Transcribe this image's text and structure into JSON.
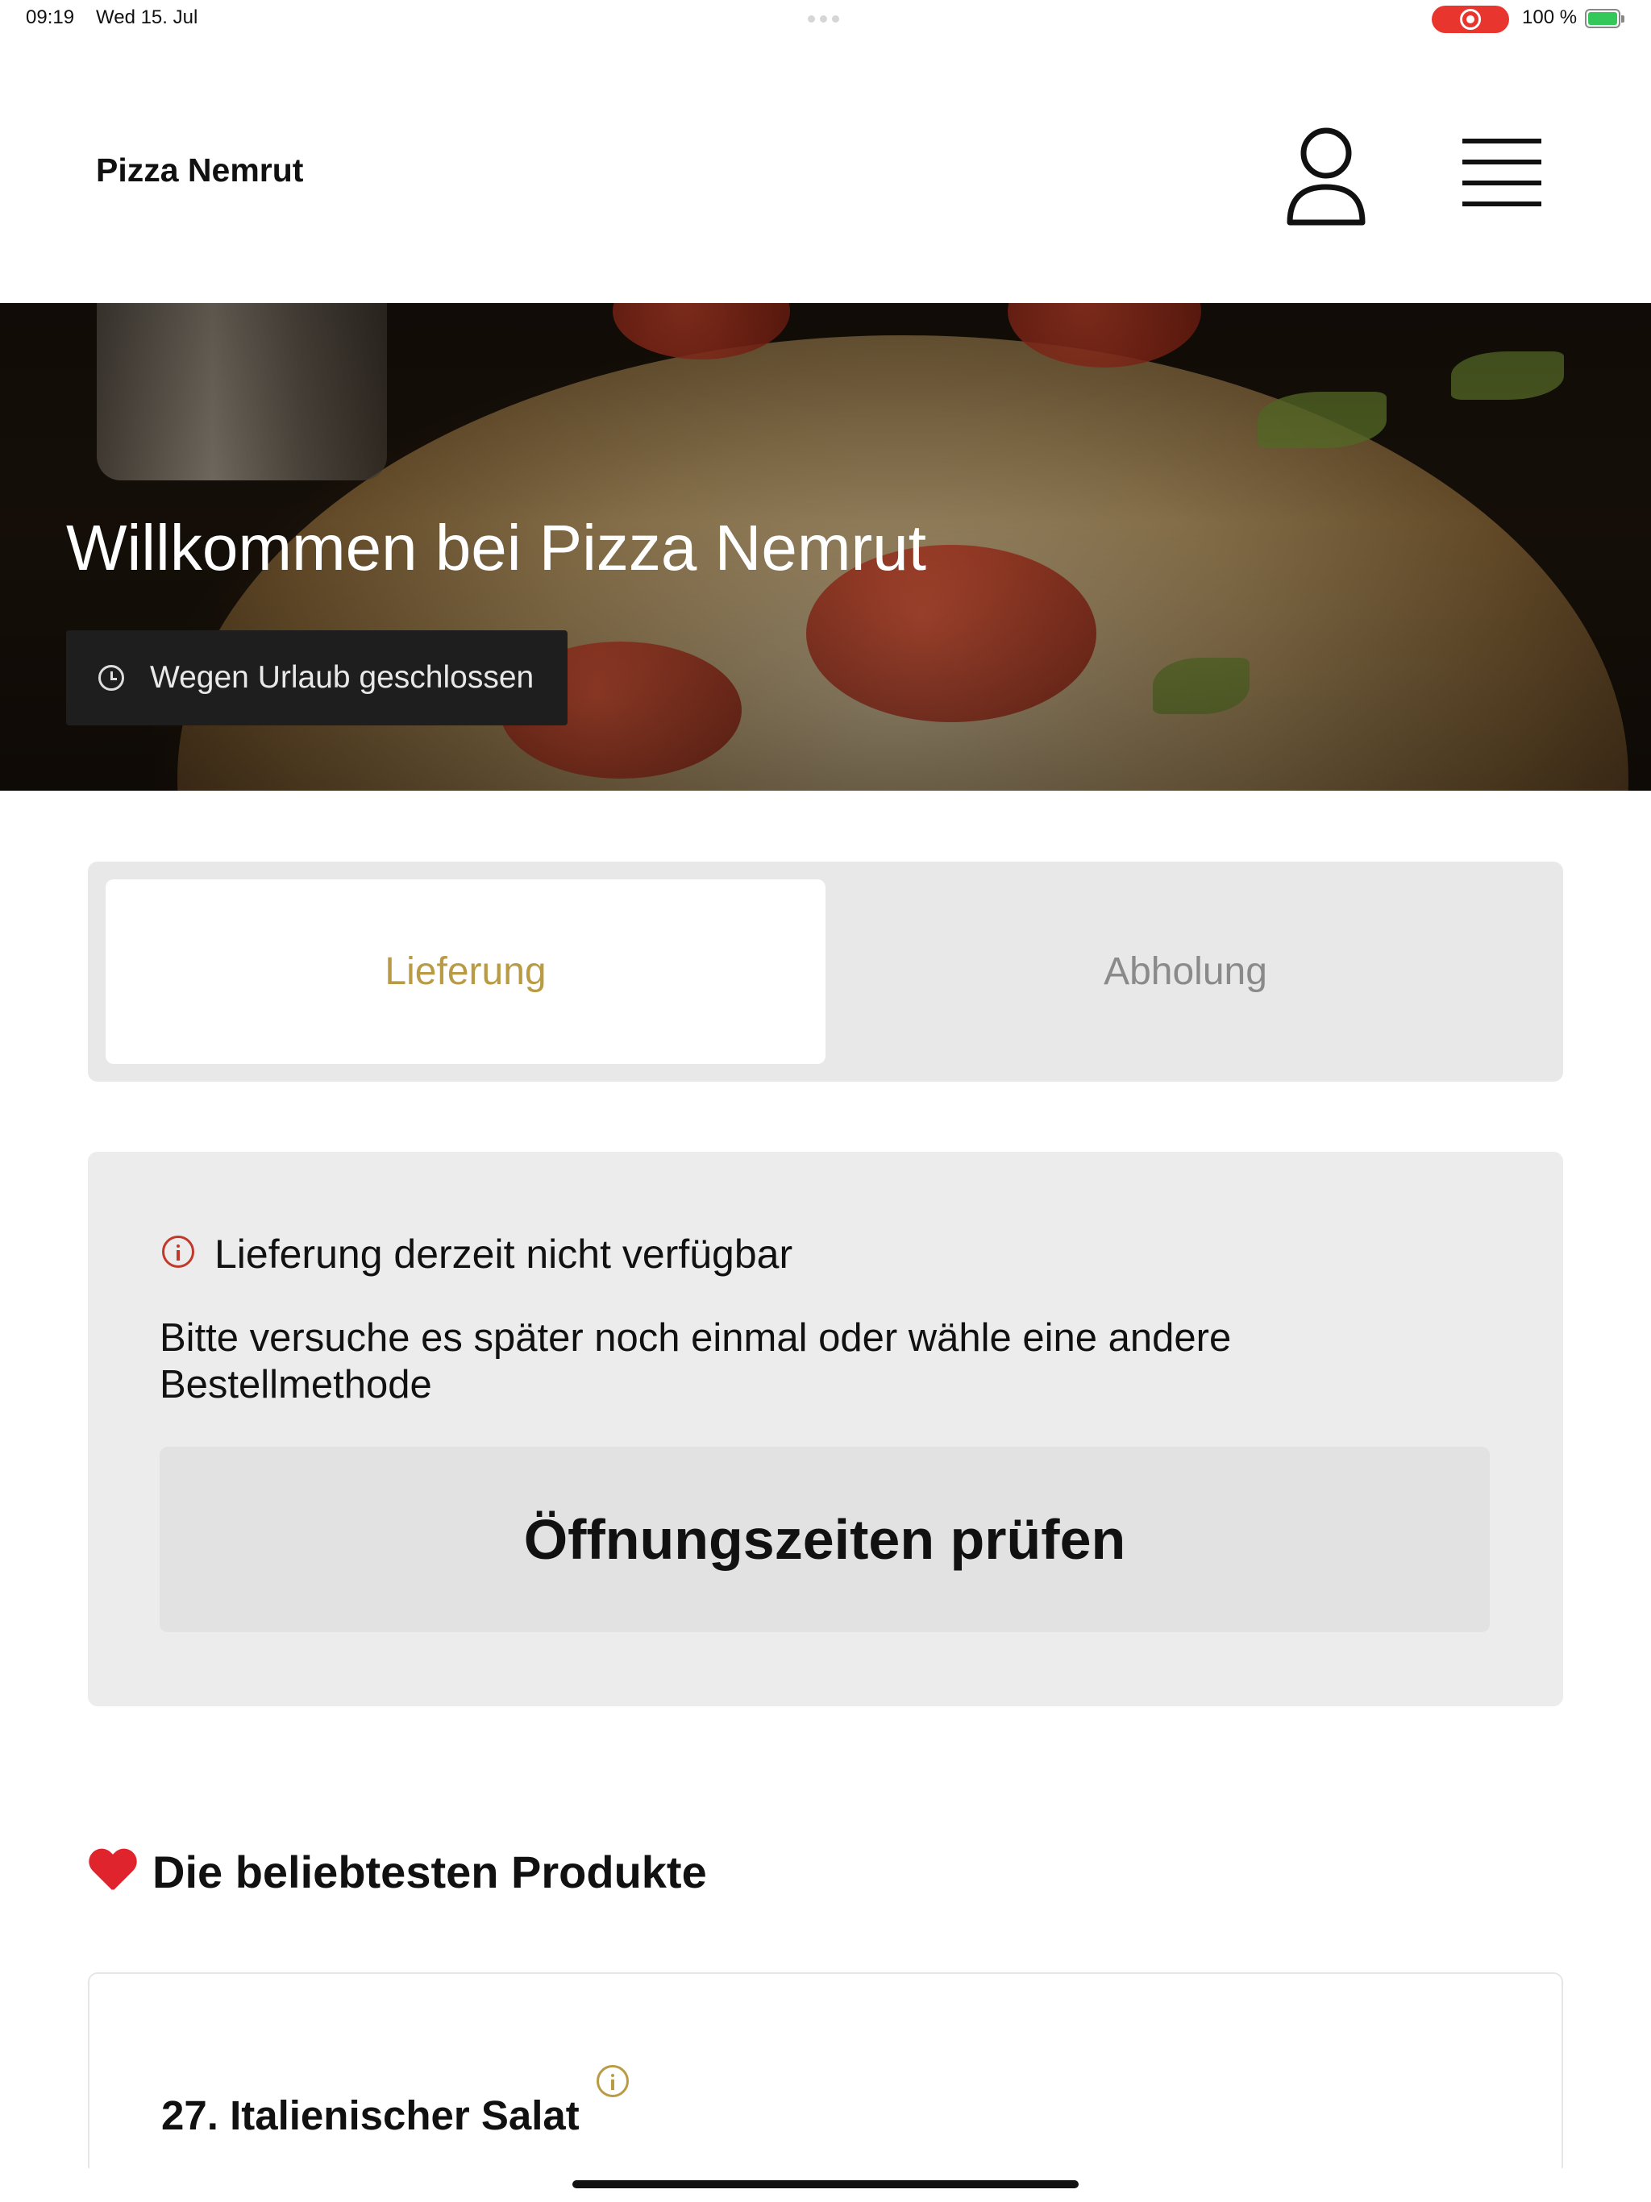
{
  "status_bar": {
    "time": "09:19",
    "date": "Wed 15. Jul",
    "battery_percent": "100 %",
    "battery_level": 1.0,
    "record_color": "#e8352e"
  },
  "header": {
    "brand": "Pizza Nemrut",
    "profile_icon": "person-icon",
    "menu_icon": "hamburger-menu-icon"
  },
  "hero": {
    "title": "Willkommen bei Pizza Nemrut",
    "status_badge": "Wegen Urlaub geschlossen",
    "badge_icon": "clock-icon"
  },
  "order_method": {
    "tabs": [
      {
        "label": "Lieferung",
        "active": true
      },
      {
        "label": "Abholung",
        "active": false
      }
    ],
    "accent_color": "#b99b45"
  },
  "notice": {
    "icon": "info-icon",
    "icon_color": "#c0392b",
    "title": "Lieferung derzeit nicht verfügbar",
    "body": "Bitte versuche es später noch einmal oder wähle eine andere Bestellmethode",
    "button_label": "Öffnungszeiten prüfen"
  },
  "popular": {
    "icon": "heart-icon",
    "title": "Die beliebtesten Produkte",
    "products": [
      {
        "name": "27. Italienischer Salat",
        "info_icon": "info-icon"
      }
    ]
  }
}
